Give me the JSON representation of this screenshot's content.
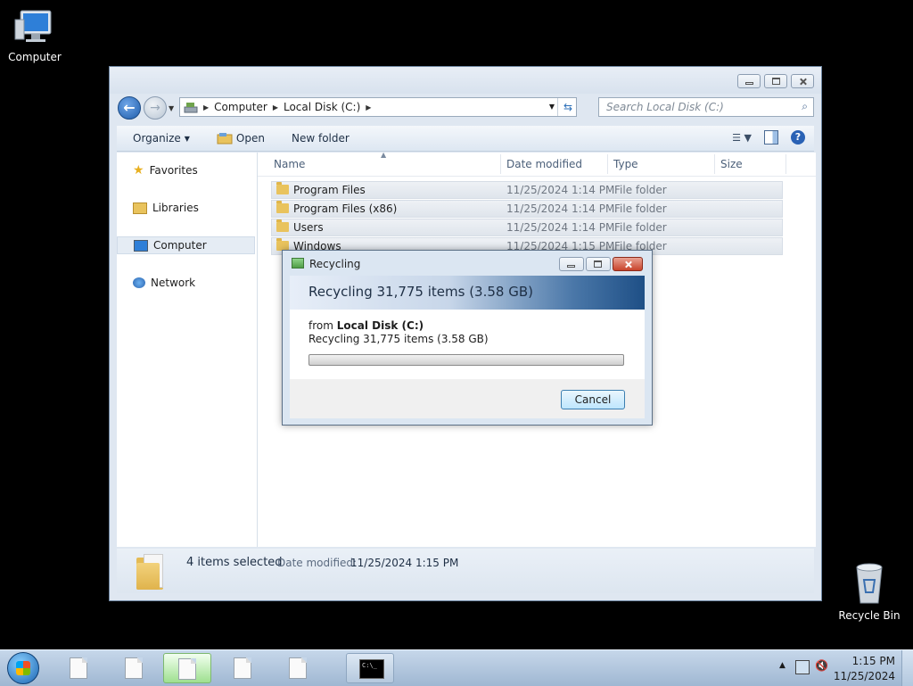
{
  "desktop": {
    "computer_label": "Computer",
    "recycle_bin_label": "Recycle Bin"
  },
  "explorer": {
    "address": {
      "seg1": "Computer",
      "seg2": "Local Disk (C:)"
    },
    "search_placeholder": "Search Local Disk (C:)",
    "toolbar": {
      "organize": "Organize",
      "open": "Open",
      "new_folder": "New folder"
    },
    "nav": {
      "favorites": "Favorites",
      "libraries": "Libraries",
      "computer": "Computer",
      "network": "Network"
    },
    "columns": {
      "name": "Name",
      "date": "Date modified",
      "type": "Type",
      "size": "Size"
    },
    "rows": [
      {
        "name": "Program Files",
        "date": "11/25/2024 1:14 PM",
        "type": "File folder"
      },
      {
        "name": "Program Files (x86)",
        "date": "11/25/2024 1:14 PM",
        "type": "File folder"
      },
      {
        "name": "Users",
        "date": "11/25/2024 1:14 PM",
        "type": "File folder"
      },
      {
        "name": "Windows",
        "date": "11/25/2024 1:15 PM",
        "type": "File folder"
      }
    ],
    "details": {
      "count": "4 items selected",
      "date_label": "Date modified:",
      "date_value": "11/25/2024 1:15 PM"
    }
  },
  "dialog": {
    "title": "Recycling",
    "heading": "Recycling 31,775 items (3.58 GB)",
    "from_prefix": "from",
    "from_location": "Local Disk (C:)",
    "description": "Recycling 31,775 items (3.58 GB)",
    "progress_fraction": 0.0,
    "cancel_label": "Cancel"
  },
  "taskbar": {
    "time": "1:15 PM",
    "date": "11/25/2024"
  },
  "icons": {
    "computer": "computer-icon",
    "recycle_bin": "recycle-bin-icon",
    "folder": "folder-icon",
    "star": "star-icon",
    "libraries": "libraries-icon",
    "network": "network-icon",
    "help": "help-icon"
  }
}
